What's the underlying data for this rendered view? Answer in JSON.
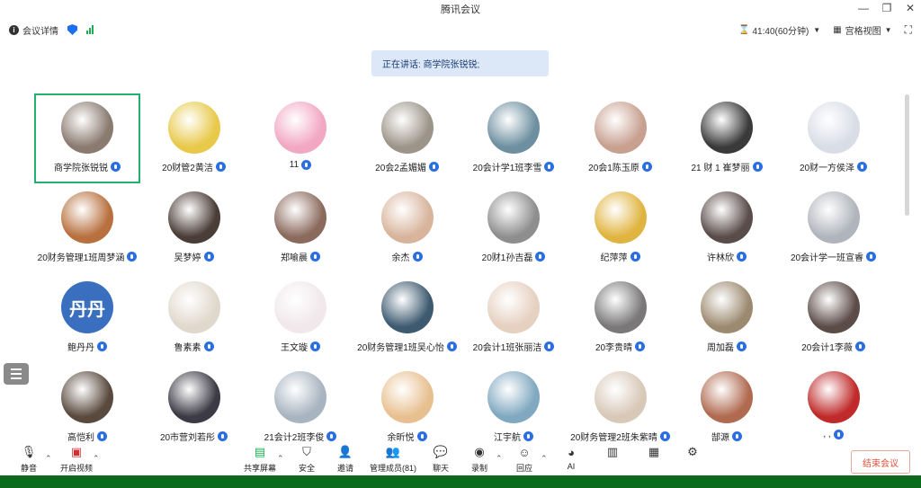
{
  "window": {
    "title": "腾讯会议"
  },
  "topbar": {
    "meeting_details": "会议详情",
    "timer": "41:40(60分钟)",
    "view_mode": "宫格视图"
  },
  "speaker_banner": "正在讲话: 商学院张锐锐;",
  "participants": [
    {
      "name": "商学院张锐锐",
      "color": "#8a7a70",
      "active": true
    },
    {
      "name": "20财管2黄洁",
      "color": "#e8c94a"
    },
    {
      "name": "11",
      "color": "#f2a7c3"
    },
    {
      "name": "20会2孟媚媚",
      "color": "#9c9488"
    },
    {
      "name": "20会计学1班李雪",
      "color": "#6d8fa0"
    },
    {
      "name": "20会1陈玉原",
      "color": "#c8a090"
    },
    {
      "name": "21 财 1 崔梦丽",
      "color": "#3a3a3a"
    },
    {
      "name": "20财一方侯泽",
      "color": "#d9dde6"
    },
    {
      "name": "20财务管理1班周梦涵",
      "color": "#b8703e"
    },
    {
      "name": "吴梦婷",
      "color": "#4a3c36"
    },
    {
      "name": "郑喻晨",
      "color": "#8b6a5e"
    },
    {
      "name": "余杰",
      "color": "#d8b49c"
    },
    {
      "name": "20财1孙吉磊",
      "color": "#8e8e8e"
    },
    {
      "name": "纪萍萍",
      "color": "#e0b440"
    },
    {
      "name": "许林欣",
      "color": "#5a4c4a"
    },
    {
      "name": "20会计学一班宣睿",
      "color": "#b0b4bc"
    },
    {
      "name": "鲍丹丹",
      "color": "#3a6fc0",
      "text": "丹丹"
    },
    {
      "name": "鲁素素",
      "color": "#e0d8cc"
    },
    {
      "name": "王文璇",
      "color": "#f0e8ea"
    },
    {
      "name": "20财务管理1班吴心怡",
      "color": "#3e5a70"
    },
    {
      "name": "20会计1班张丽洁",
      "color": "#e6d0c0"
    },
    {
      "name": "20李贵晴",
      "color": "#7a7878"
    },
    {
      "name": "周加磊",
      "color": "#9c8a70"
    },
    {
      "name": "20会计1李薇",
      "color": "#5c4c48"
    },
    {
      "name": "高恺利",
      "color": "#5a4a3e"
    },
    {
      "name": "20市营刘若彤",
      "color": "#3c3a44"
    },
    {
      "name": "21会计2班李俊",
      "color": "#a8b4c0"
    },
    {
      "name": "余昕悦",
      "color": "#e8c090"
    },
    {
      "name": "江宇航",
      "color": "#80a8c0"
    },
    {
      "name": "20财务管理2班朱紫晴",
      "color": "#d8c8b8"
    },
    {
      "name": "郜源",
      "color": "#b06a50"
    },
    {
      "name": ", ,",
      "color": "#c02a2a"
    }
  ],
  "toolbar": {
    "mute": "静音",
    "start_video": "开启视频",
    "share_screen": "共享屏幕",
    "security": "安全",
    "invite": "邀请",
    "manage_members": "管理成员(81)",
    "chat": "聊天",
    "record": "录制",
    "reactions": "回应",
    "ai": "AI",
    "end_meeting": "结束会议"
  }
}
